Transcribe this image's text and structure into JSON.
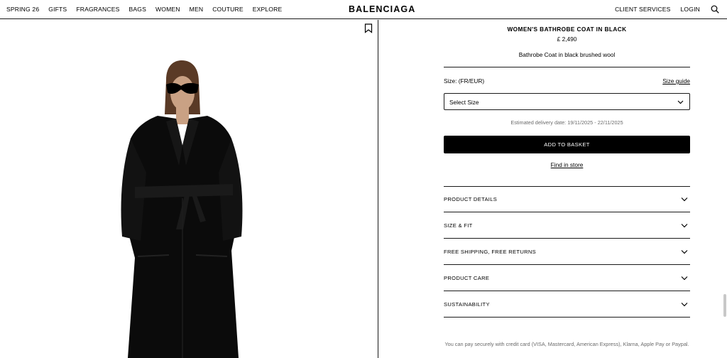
{
  "header": {
    "nav_left": [
      "SPRING 26",
      "GIFTS",
      "FRAGRANCES",
      "BAGS",
      "WOMEN",
      "MEN",
      "COUTURE",
      "EXPLORE"
    ],
    "logo": "BALENCIAGA",
    "nav_right": [
      "CLIENT SERVICES",
      "LOGIN"
    ],
    "search_icon": "search-icon"
  },
  "product": {
    "title": "WOMEN'S BATHROBE COAT IN BLACK",
    "price": "£ 2,490",
    "description": "Bathrobe Coat in black brushed wool",
    "size_label": "Size: (FR/EUR)",
    "size_guide": "Size guide",
    "select_placeholder": "Select Size",
    "delivery": "Estimated delivery date: 19/11/2025 - 22/11/2025",
    "add_to_basket": "ADD TO BASKET",
    "find_in_store": "Find in store",
    "bookmark_icon": "bookmark-icon"
  },
  "accordion": [
    {
      "label": "PRODUCT DETAILS"
    },
    {
      "label": "SIZE & FIT"
    },
    {
      "label": "FREE SHIPPING, FREE RETURNS"
    },
    {
      "label": "PRODUCT CARE"
    },
    {
      "label": "SUSTAINABILITY"
    }
  ],
  "payment_note": "You can pay securely with credit card (VISA, Mastercard, American Express), Klarna, Apple Pay or Paypal.",
  "colors": {
    "accent": "#000000",
    "muted_text": "#6b6b6b",
    "background": "#ffffff"
  }
}
